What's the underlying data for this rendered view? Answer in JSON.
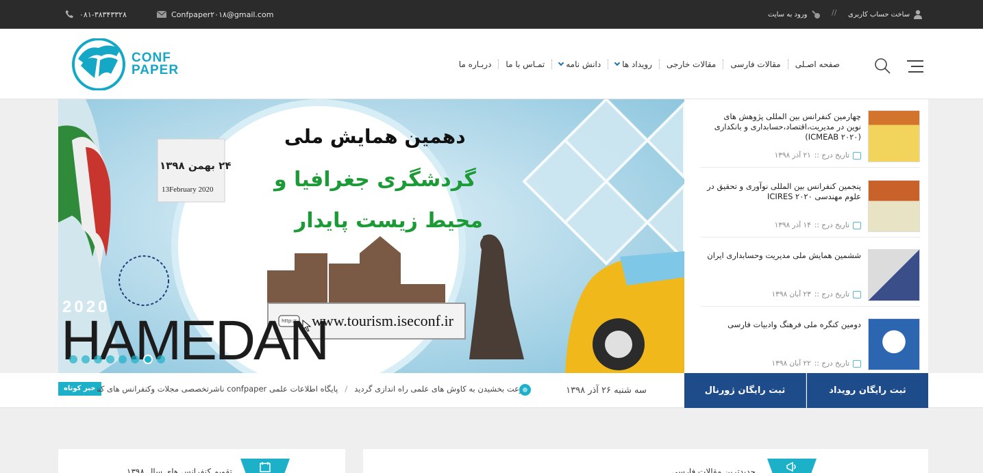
{
  "topbar": {
    "phone": "۰۸۱-۳۸۳۴۳۳۲۸",
    "email": "Confpaper۲۰۱۸@gmail.com",
    "register": "ساخت حساب کاربری",
    "separator": "//",
    "login": "ورود به سایت"
  },
  "logo": {
    "line1": "CONF",
    "line2": "PAPER"
  },
  "nav": {
    "items": [
      {
        "label": "صفحه اصـلی",
        "dropdown": false
      },
      {
        "label": "مقالات فارسی",
        "dropdown": false
      },
      {
        "label": "مقالات خارجی",
        "dropdown": false
      },
      {
        "label": "رویداد ها",
        "dropdown": true
      },
      {
        "label": "دانش نامه",
        "dropdown": true
      },
      {
        "label": "تمـاس با ما",
        "dropdown": false
      },
      {
        "label": "دربـاره ما",
        "dropdown": false
      }
    ]
  },
  "hero": {
    "title1": "دهمین همایش ملی",
    "title2": "گردشگری جغرافیا و",
    "title3": "محیط زیست پایدار",
    "date_fa": "۲۴ بهمن ۱۳۹۸",
    "date_en": "13February 2020",
    "url_badge": "http://",
    "url": "www.tourism.iseconf.ir",
    "year": "2020",
    "city": "HAMEDAN",
    "slide_dots": 8,
    "active_dot": 6
  },
  "sidebar": {
    "date_label": "تاریخ درج ::",
    "items": [
      {
        "title": "چهارمین کنفرانس بین المللی پژوهش های نوین در مدیریت،اقتصاد،حسابداری و بانکداری (۲۰۲۰ ICMEAB)",
        "date": "۲۱ آذر ۱۳۹۸"
      },
      {
        "title": "پنجمین کنفرانس بین المللی نوآوری و تحقیق در علوم مهندسی ۲۰۲۰ ICIRES",
        "date": "۱۴ آذر ۱۳۹۸"
      },
      {
        "title": "ششمین همایش ملی مدیریت وحسابداری ایران",
        "date": "۲۳ آبان ۱۳۹۸"
      },
      {
        "title": "دومین کنگره ملی فرهنگ وادبیات فارسی",
        "date": "۲۲ آبان ۱۳۹۸"
      }
    ]
  },
  "ticker": {
    "tag": "خبر کوتاه",
    "items": [
      "سرعت بخشیدن به کاوش های علمی راه اندازی گردید",
      "/",
      "پایگاه اطلاعات علمی confpaper ناشرتخصصی مجلات وکنفرانس های کشور"
    ]
  },
  "today": "سه شنبه ۲۶ آذر ۱۳۹۸",
  "register_buttons": {
    "journal": "ثبت رایگان ژورنال",
    "event": "ثبت رایگان رویداد"
  },
  "panels": {
    "left_title": "تقویم کنفرانس های سال ۱۳۹۸",
    "right_title": "جدیدترین مقالات فارسی"
  },
  "colors": {
    "accent": "#1db0c9",
    "navy": "#1e4c8a",
    "topbar": "#2b2b2b"
  }
}
